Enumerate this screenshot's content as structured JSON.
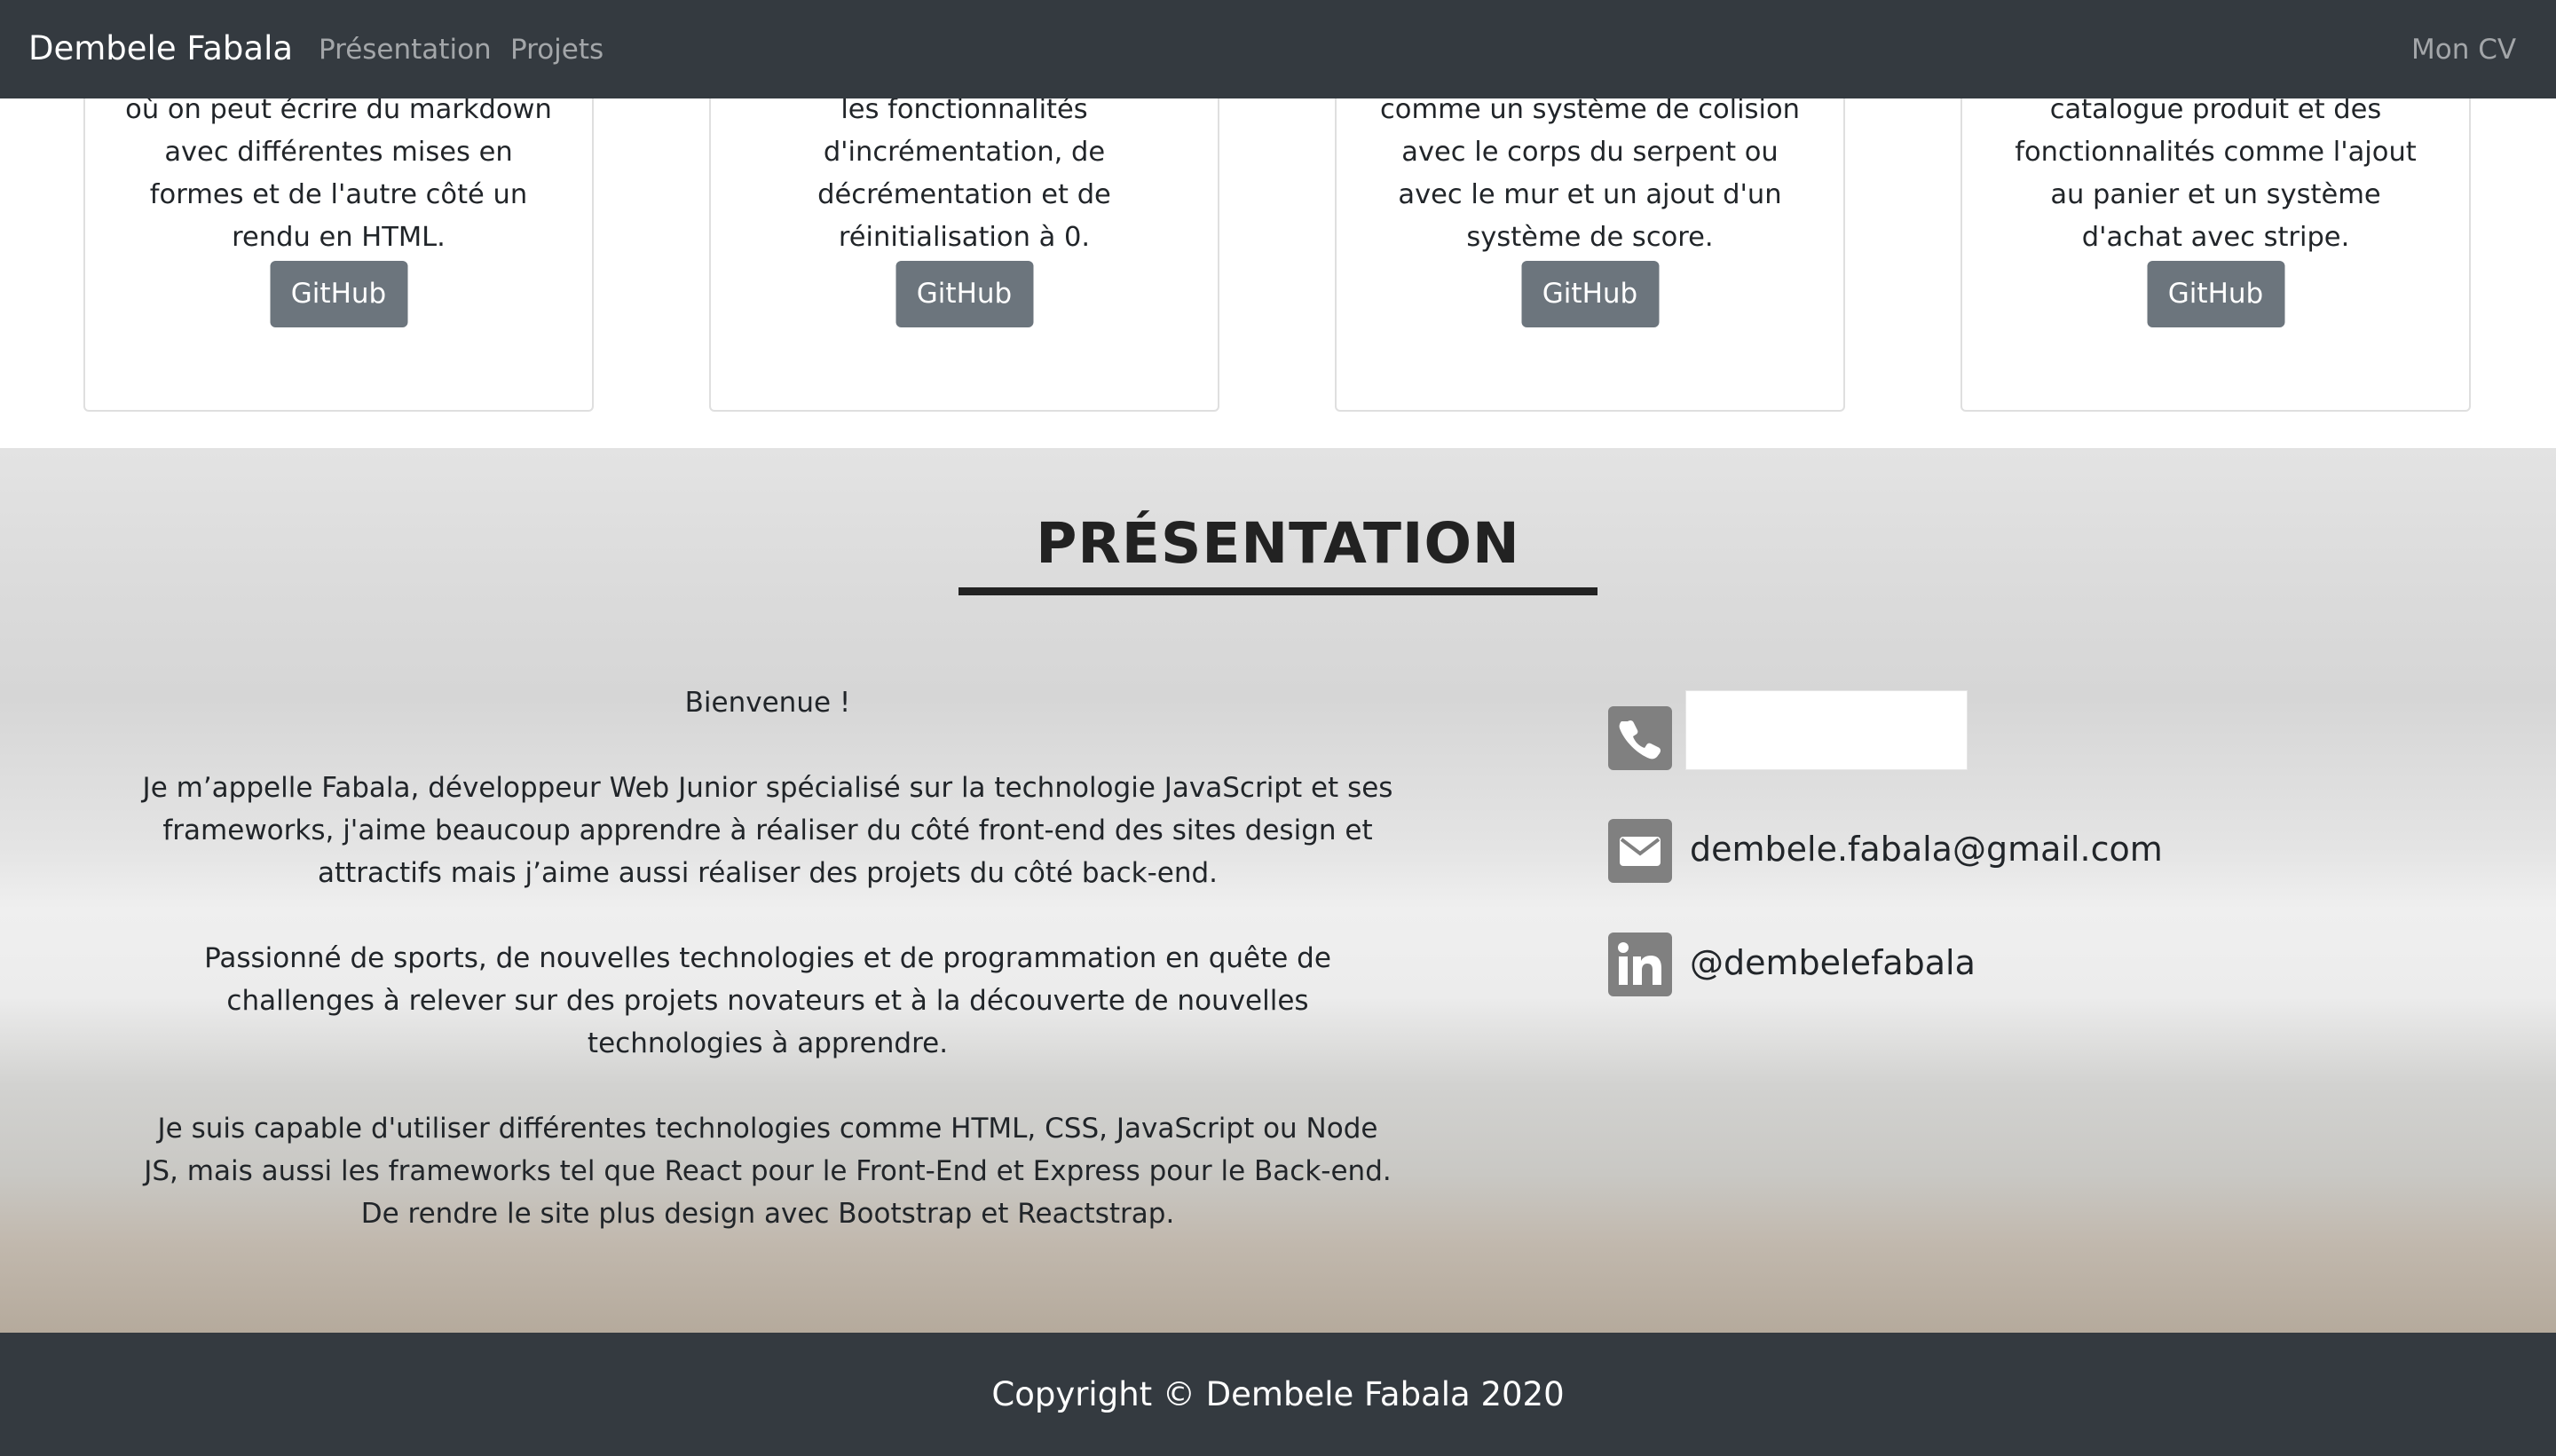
{
  "navbar": {
    "brand": "Dembele Fabala",
    "links": [
      "Présentation",
      "Projets"
    ],
    "cv_link": "Mon CV"
  },
  "projects": {
    "cards": [
      {
        "text": "où on peut écrire du markdown avec différentes mises en formes et de l'autre côté un rendu en HTML.",
        "button": "GitHub"
      },
      {
        "text": "les fonctionnalités d'incrémentation, de décrémentation et de réinitialisation à 0.",
        "button": "GitHub"
      },
      {
        "text": "comme un système de colision avec le corps du serpent ou avec le mur et un ajout d'un système de score.",
        "button": "GitHub"
      },
      {
        "text": "catalogue produit et des fonctionnalités comme l'ajout au panier et un système d'achat avec stripe.",
        "button": "GitHub"
      }
    ]
  },
  "presentation": {
    "title": "PRÉSENTATION",
    "paragraphs": [
      "Bienvenue !",
      "Je m’appelle Fabala, développeur Web Junior spécialisé sur la technologie JavaScript et ses frameworks, j'aime beaucoup apprendre à réaliser du côté front-end des sites design et attractifs mais j’aime aussi réaliser des projets du côté back-end.",
      "Passionné de sports, de nouvelles technologies et de programmation en quête de challenges à relever sur des projets novateurs et à la découverte de nouvelles technologies à apprendre.",
      "Je suis capable d'utiliser différentes technologies comme HTML, CSS, JavaScript ou Node JS, mais aussi les frameworks tel que React pour le Front-End et Express pour le Back-end. De rendre le site plus design avec Bootstrap et Reactstrap."
    ],
    "contacts": {
      "phone_icon": "phone-icon",
      "email_icon": "envelope-icon",
      "email": "dembele.fabala@gmail.com",
      "linkedin_icon": "linkedin-icon",
      "linkedin": "@dembelefabala"
    }
  },
  "footer": {
    "copyright": "Copyright © Dembele Fabala 2020"
  },
  "colors": {
    "navbar_bg": "#343a40",
    "button_bg": "#6c757d",
    "icon_bg": "#808080"
  }
}
